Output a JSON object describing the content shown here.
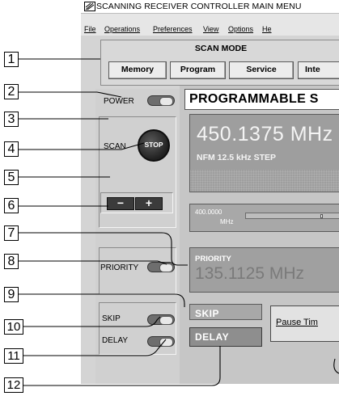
{
  "window": {
    "title": "SCANNING RECEIVER CONTROLLER MAIN MENU"
  },
  "menu": [
    "File",
    "Operations",
    "Preferences",
    "View",
    "Options",
    "He"
  ],
  "scan_mode": {
    "title": "SCAN MODE",
    "buttons": [
      "Memory",
      "Program",
      "Service",
      "Inte"
    ]
  },
  "left_panel": {
    "power_label": "POWER",
    "scan_label": "SCAN",
    "stop_label": "STOP",
    "minus_label": "−",
    "plus_label": "+",
    "priority_label": "PRIORITY",
    "skip_label": "SKIP",
    "delay_label": "DELAY"
  },
  "display": {
    "header": "PROGRAMMABLE S",
    "frequency": "450.1375 MHz",
    "mode_step": "NFM   12.5 kHz STEP",
    "range_top": "400.0000",
    "range_unit": "MHz",
    "range_position": 0.68,
    "priority_label": "PRIORITY",
    "priority_frequency": "135.1125 MHz",
    "skip_indicator": "SKIP",
    "delay_indicator": "DELAY",
    "pause_button": "Pause Tim"
  },
  "callouts": [
    "1",
    "2",
    "3",
    "4",
    "5",
    "6",
    "7",
    "8",
    "9",
    "10",
    "11",
    "12"
  ]
}
